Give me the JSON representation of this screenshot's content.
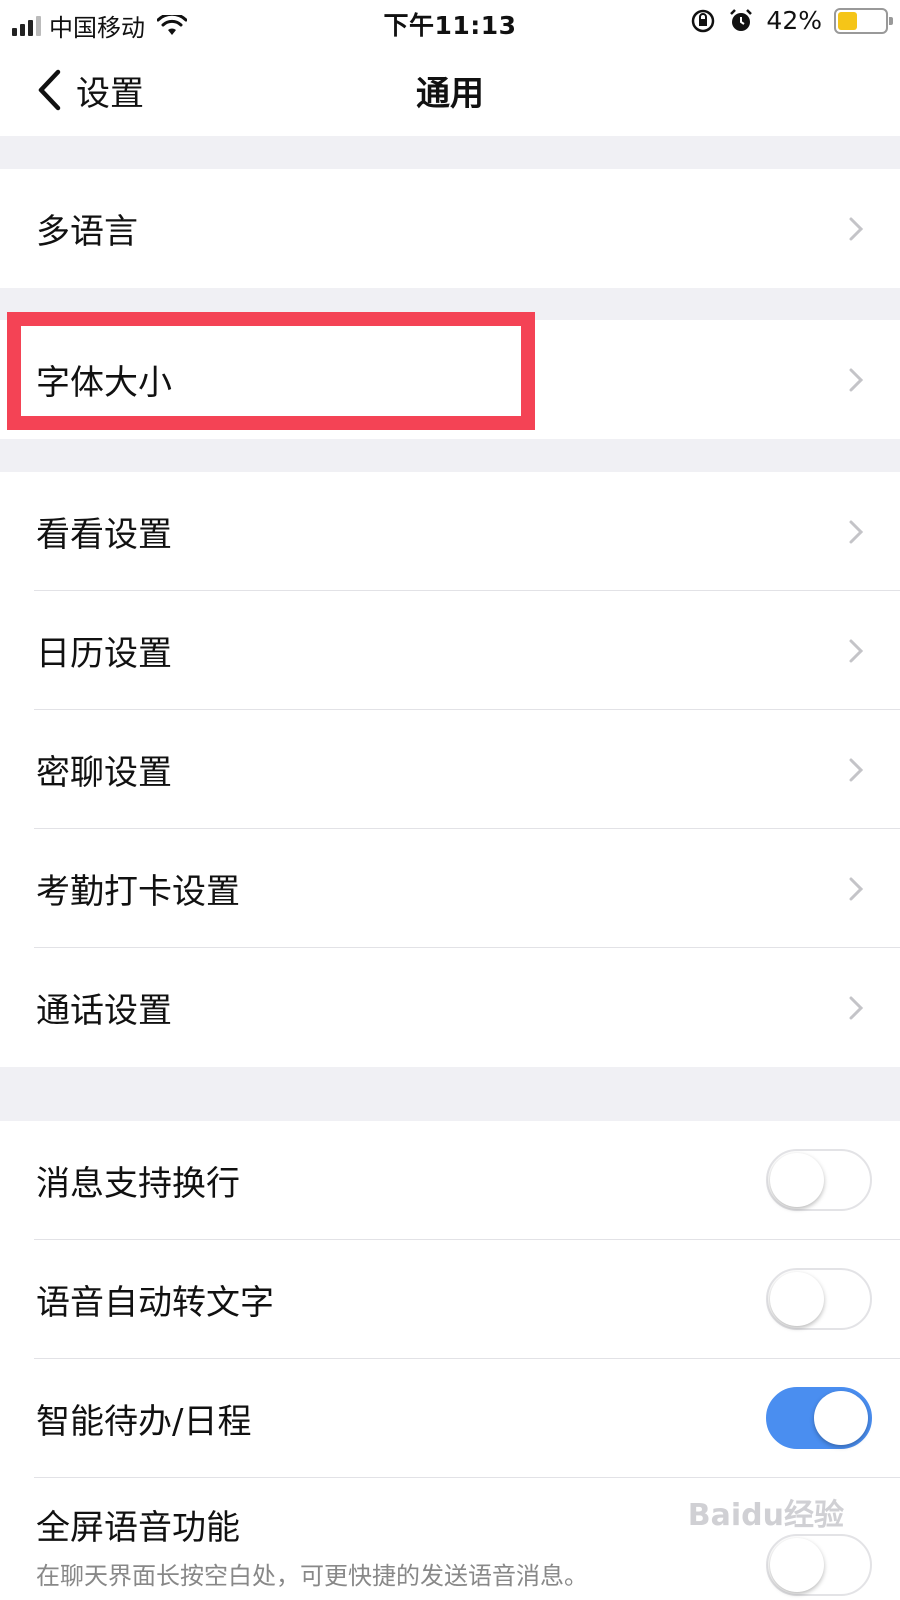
{
  "status_bar": {
    "carrier": "中国移动",
    "time": "下午11:13",
    "battery_percent": "42%",
    "battery_level": 0.42,
    "battery_color": "#f5c518",
    "icons": [
      "signal-icon",
      "wifi-icon",
      "orientation-lock-icon",
      "alarm-icon",
      "battery-icon"
    ]
  },
  "nav": {
    "back_label": "设置",
    "title": "通用"
  },
  "groups": {
    "language": {
      "label": "多语言"
    },
    "font": {
      "label": "字体大小"
    },
    "settings": {
      "items": [
        {
          "label": "看看设置"
        },
        {
          "label": "日历设置"
        },
        {
          "label": "密聊设置"
        },
        {
          "label": "考勤打卡设置"
        },
        {
          "label": "通话设置"
        }
      ]
    },
    "toggles": {
      "items": [
        {
          "label": "消息支持换行",
          "on": false
        },
        {
          "label": "语音自动转文字",
          "on": false
        },
        {
          "label": "智能待办/日程",
          "on": true
        },
        {
          "label": "全屏语音功能",
          "sublabel": "在聊天界面长按空白处，可更快捷的发送语音消息。",
          "on": false
        }
      ]
    }
  },
  "accent_color": "#4a8ef0",
  "highlight_color": "#f44355",
  "watermark": "Baidu经验"
}
